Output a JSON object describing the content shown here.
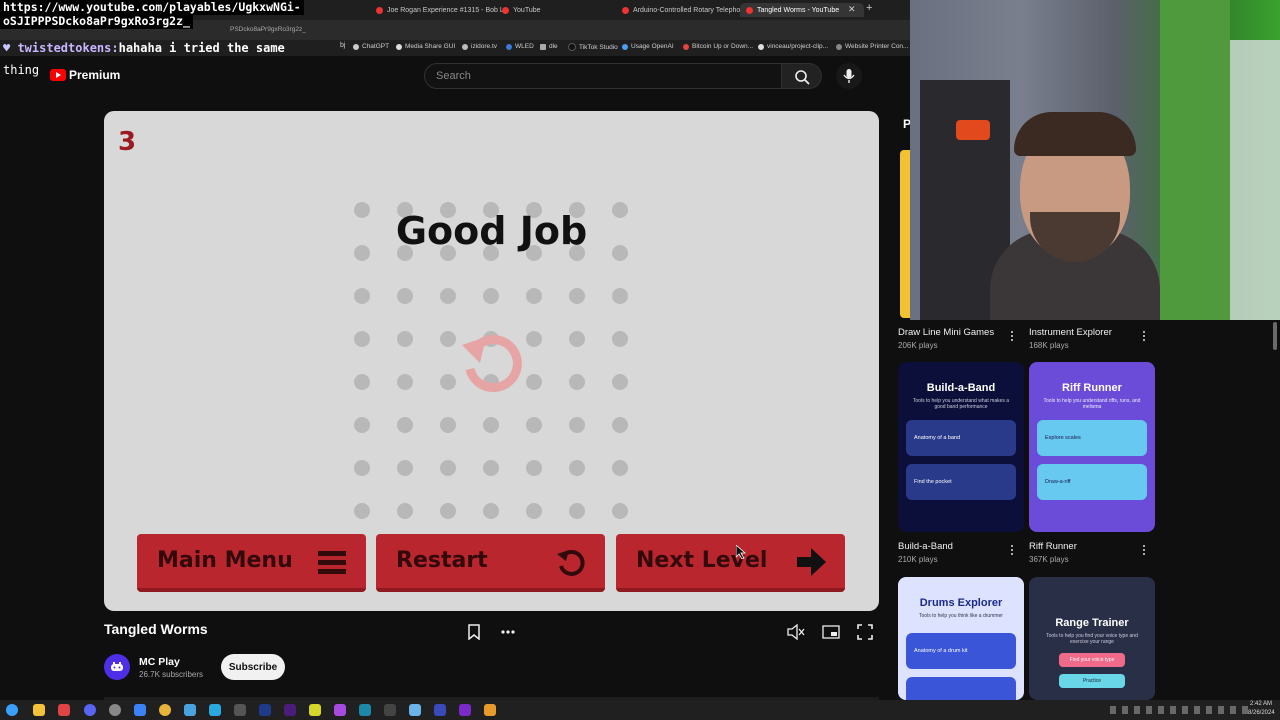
{
  "browser": {
    "tabs": [
      {
        "label": "Joe Rogan Experience #1315 - Bob L"
      },
      {
        "label": "YouTube"
      },
      {
        "label": "Arduino-Controlled Rotary Telephon"
      },
      {
        "label": "Tangled Worms - YouTube"
      }
    ],
    "address": "PSDcko8aPr9gxRo3rg2z_",
    "bookmarks": [
      {
        "label": "ChatGPT",
        "color": "#cccccc"
      },
      {
        "label": "Media Share GUI",
        "color": "#dddddd"
      },
      {
        "label": "izidore.tv",
        "color": "#bbbbbb"
      },
      {
        "label": "WLED",
        "color": "#3a7bd5"
      },
      {
        "label": "dle",
        "color": "#aaaaaa"
      },
      {
        "label": "TikTok Studio",
        "color": "#111111"
      },
      {
        "label": "Usage OpenAI",
        "color": "#4a9ff5"
      },
      {
        "label": "Bitcoin Up or Down...",
        "color": "#e54242"
      },
      {
        "label": "vinceau/project-clip...",
        "color": "#dddddd"
      },
      {
        "label": "Website Printer Con...",
        "color": "#888888"
      }
    ]
  },
  "overlay": {
    "url_line1": "https://www.youtube.com/playables/UgkxwNGi-",
    "url_line2": "oSJIPPPSDcko8aPr9gxRo3rg2z_",
    "chat_user": "twistedtokens:",
    "chat_msg": "hahaha i tried the same",
    "chat_msg2": "thing"
  },
  "youtube": {
    "brand": "Premium",
    "search_placeholder": "Search"
  },
  "game": {
    "level": "3",
    "message": "Good Job",
    "buttons": {
      "main_menu": "Main Menu",
      "restart": "Restart",
      "next_level": "Next Level"
    },
    "colors": {
      "accent": "#b9262e",
      "background": "#d8d8d8"
    }
  },
  "video": {
    "title": "Tangled Worms",
    "channel": "MC Play",
    "subscribers": "26.7K subscribers",
    "subscribe_label": "Subscribe"
  },
  "sidebar": {
    "heading_partial": "P",
    "cards": [
      {
        "title": "Draw Line Mini Games",
        "plays": "206K plays"
      },
      {
        "title": "Instrument Explorer",
        "plays": "168K plays"
      },
      {
        "title": "Build-a-Band",
        "plays": "210K plays",
        "thumb_title": "Build-a-Band",
        "thumb_sub": "Tools to help you understand what makes a good band performance",
        "rows": [
          "Anatomy of a band",
          "Find the pocket"
        ]
      },
      {
        "title": "Riff Runner",
        "plays": "367K plays",
        "thumb_title": "Riff Runner",
        "thumb_sub": "Tools to help you understand riffs, runs, and melisma",
        "rows": [
          "Explore scales",
          "Draw-a-riff"
        ]
      },
      {
        "title": "Drums Explorer",
        "thumb_title": "Drums Explorer",
        "thumb_sub": "Tools to help you think like a drummer",
        "rows": [
          "Anatomy of a drum kit"
        ]
      },
      {
        "title": "Range Trainer",
        "thumb_title": "Range Trainer",
        "thumb_sub": "Tools to help you find your voice type and exercise your range",
        "rows": [
          "Find your voice type",
          "Practice"
        ]
      }
    ]
  },
  "taskbar": {
    "time": "2:42 AM",
    "date": "8/26/2024"
  }
}
